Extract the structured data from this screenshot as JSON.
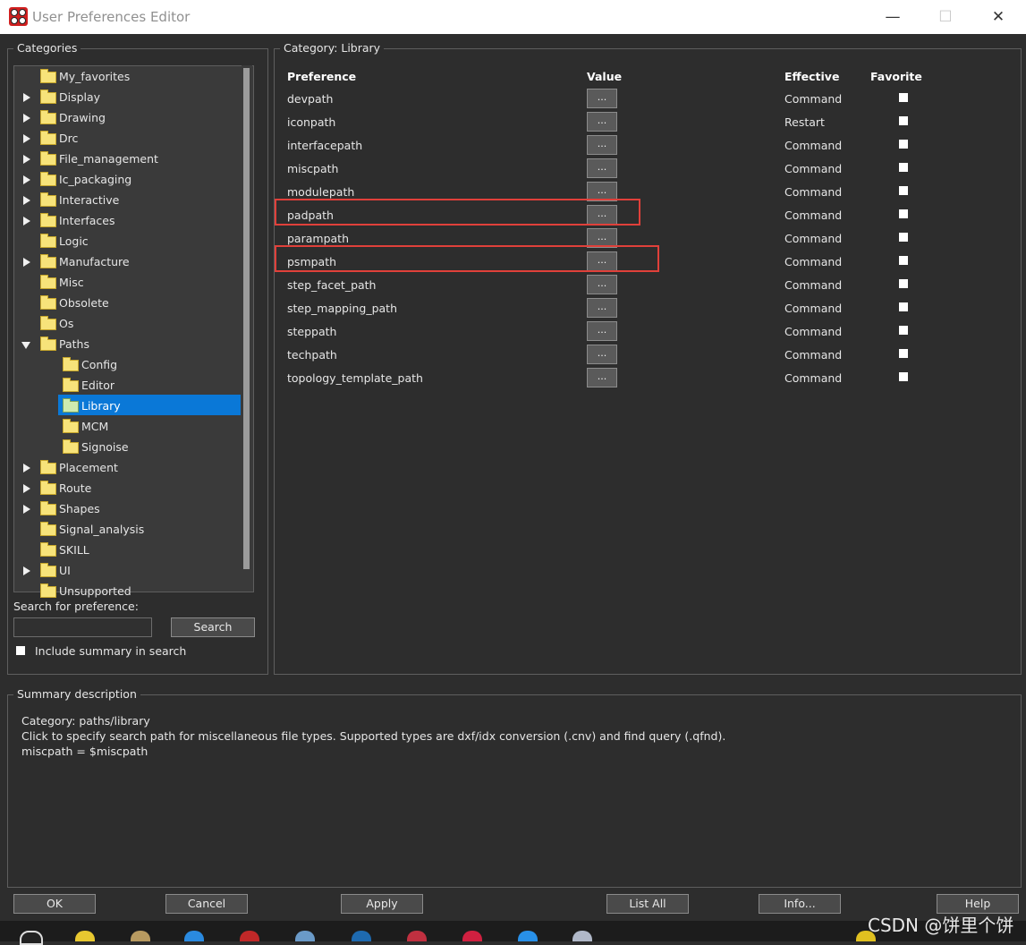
{
  "window": {
    "title": "User Preferences Editor",
    "min_glyph": "—",
    "max_glyph": "☐",
    "close_glyph": "✕"
  },
  "categories": {
    "title": "Categories",
    "items": [
      {
        "label": "My_favorites",
        "expander": "none",
        "level": 0
      },
      {
        "label": "Display",
        "expander": "collapsed",
        "level": 0
      },
      {
        "label": "Drawing",
        "expander": "collapsed",
        "level": 0
      },
      {
        "label": "Drc",
        "expander": "collapsed",
        "level": 0
      },
      {
        "label": "File_management",
        "expander": "collapsed",
        "level": 0
      },
      {
        "label": "Ic_packaging",
        "expander": "collapsed",
        "level": 0
      },
      {
        "label": "Interactive",
        "expander": "collapsed",
        "level": 0
      },
      {
        "label": "Interfaces",
        "expander": "collapsed",
        "level": 0
      },
      {
        "label": "Logic",
        "expander": "none",
        "level": 0
      },
      {
        "label": "Manufacture",
        "expander": "collapsed",
        "level": 0
      },
      {
        "label": "Misc",
        "expander": "none",
        "level": 0
      },
      {
        "label": "Obsolete",
        "expander": "none",
        "level": 0
      },
      {
        "label": "Os",
        "expander": "none",
        "level": 0
      },
      {
        "label": "Paths",
        "expander": "expanded",
        "level": 0
      },
      {
        "label": "Config",
        "expander": "none",
        "level": 1
      },
      {
        "label": "Editor",
        "expander": "none",
        "level": 1
      },
      {
        "label": "Library",
        "expander": "none",
        "level": 1,
        "selected": true
      },
      {
        "label": "MCM",
        "expander": "none",
        "level": 1
      },
      {
        "label": "Signoise",
        "expander": "none",
        "level": 1
      },
      {
        "label": "Placement",
        "expander": "collapsed",
        "level": 0
      },
      {
        "label": "Route",
        "expander": "collapsed",
        "level": 0
      },
      {
        "label": "Shapes",
        "expander": "collapsed",
        "level": 0
      },
      {
        "label": "Signal_analysis",
        "expander": "none",
        "level": 0
      },
      {
        "label": "SKILL",
        "expander": "none",
        "level": 0
      },
      {
        "label": "UI",
        "expander": "collapsed",
        "level": 0
      },
      {
        "label": "Unsupported",
        "expander": "none",
        "level": 0
      }
    ],
    "search_label": "Search for preference:",
    "search_value": "",
    "search_button": "Search",
    "include_summary_label": "Include summary in search"
  },
  "category_panel": {
    "title": "Category:  Library",
    "headers": {
      "preference": "Preference",
      "value": "Value",
      "effective": "Effective",
      "favorite": "Favorite"
    },
    "value_button_label": "...",
    "rows": [
      {
        "name": "devpath",
        "effective": "Command"
      },
      {
        "name": "iconpath",
        "effective": "Restart"
      },
      {
        "name": "interfacepath",
        "effective": "Command"
      },
      {
        "name": "miscpath",
        "effective": "Command"
      },
      {
        "name": "modulepath",
        "effective": "Command"
      },
      {
        "name": "padpath",
        "effective": "Command",
        "highlighted": true
      },
      {
        "name": "parampath",
        "effective": "Command"
      },
      {
        "name": "psmpath",
        "effective": "Command",
        "highlighted": true
      },
      {
        "name": "step_facet_path",
        "effective": "Command"
      },
      {
        "name": "step_mapping_path",
        "effective": "Command"
      },
      {
        "name": "steppath",
        "effective": "Command"
      },
      {
        "name": "techpath",
        "effective": "Command"
      },
      {
        "name": "topology_template_path",
        "effective": "Command"
      }
    ]
  },
  "summary": {
    "title": "Summary description",
    "lines": [
      "Category: paths/library",
      "Click to specify search path for miscellaneous file types. Supported types are dxf/idx conversion (.cnv) and find query (.qfnd).",
      "miscpath = $miscpath"
    ]
  },
  "buttons": {
    "ok": "OK",
    "cancel": "Cancel",
    "apply": "Apply",
    "list_all": "List All",
    "info": "Info...",
    "help": "Help"
  },
  "watermark": "CSDN @饼里个饼",
  "colors": {
    "background": "#2d2d2d",
    "selection": "#0a78d7",
    "highlight_box": "#e0403a"
  }
}
